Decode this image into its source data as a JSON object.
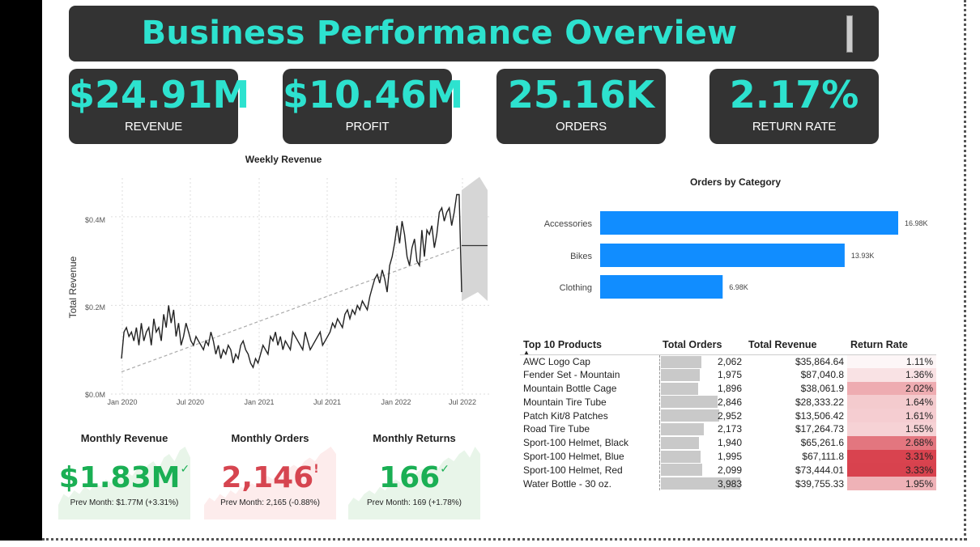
{
  "header": {
    "title": "Business Performance Overview"
  },
  "kpis": [
    {
      "value": "$24.91M",
      "label": "REVENUE"
    },
    {
      "value": "$10.46M",
      "label": "PROFIT"
    },
    {
      "value": "25.16K",
      "label": "ORDERS"
    },
    {
      "value": "2.17%",
      "label": "RETURN RATE"
    }
  ],
  "weekly_revenue": {
    "title": "Weekly Revenue",
    "ylabel": "Total Revenue",
    "yticks": [
      "$0.0M",
      "$0.2M",
      "$0.4M"
    ],
    "xticks": [
      "Jan 2020",
      "Jul 2020",
      "Jan 2021",
      "Jul 2021",
      "Jan 2022",
      "Jul 2022"
    ]
  },
  "orders_by_category": {
    "title": "Orders by Category",
    "categories": [
      "Accessories",
      "Bikes",
      "Clothing"
    ],
    "labels": [
      "16.98K",
      "13.93K",
      "6.98K"
    ]
  },
  "chart_data": [
    {
      "type": "line",
      "title": "Weekly Revenue",
      "xlabel": "",
      "ylabel": "Total Revenue",
      "ylim": [
        0,
        0.46
      ],
      "y_unit": "$M",
      "x_range": [
        "2020-01",
        "2022-07"
      ],
      "series": [
        {
          "values": [
            0.08,
            0.14,
            0.15,
            0.13,
            0.14,
            0.12,
            0.15,
            0.11,
            0.16,
            0.12,
            0.14,
            0.15,
            0.11,
            0.17,
            0.14,
            0.15,
            0.12,
            0.18,
            0.15,
            0.2,
            0.16,
            0.19,
            0.13,
            0.16,
            0.11,
            0.13,
            0.16,
            0.14,
            0.12,
            0.11,
            0.13,
            0.12,
            0.11,
            0.1,
            0.12,
            0.11,
            0.14,
            0.12,
            0.09,
            0.11,
            0.08,
            0.1,
            0.09,
            0.11,
            0.1,
            0.07,
            0.09,
            0.08,
            0.11,
            0.12,
            0.1,
            0.09,
            0.07,
            0.06,
            0.08,
            0.07,
            0.09,
            0.11,
            0.1,
            0.09,
            0.13,
            0.12,
            0.14,
            0.11,
            0.13,
            0.1,
            0.12,
            0.11,
            0.1,
            0.14,
            0.13,
            0.12,
            0.11,
            0.1,
            0.14,
            0.12,
            0.1,
            0.11,
            0.12,
            0.13,
            0.14,
            0.11,
            0.12,
            0.13,
            0.14,
            0.16,
            0.15,
            0.17,
            0.16,
            0.15,
            0.18,
            0.19,
            0.17,
            0.19,
            0.18,
            0.2,
            0.19,
            0.21,
            0.2,
            0.19,
            0.22,
            0.24,
            0.26,
            0.27,
            0.25,
            0.28,
            0.26,
            0.23,
            0.29,
            0.31,
            0.34,
            0.38,
            0.34,
            0.39,
            0.36,
            0.31,
            0.29,
            0.33,
            0.35,
            0.3,
            0.29,
            0.37,
            0.31,
            0.37,
            0.36,
            0.38,
            0.33,
            0.36,
            0.41,
            0.42,
            0.39,
            0.41,
            0.42,
            0.38,
            0.41,
            0.45,
            0.45,
            0.23
          ]
        },
        {
          "name": "trend",
          "values_start": 0.05,
          "values_end": 0.33
        },
        {
          "name": "forecast",
          "value": 0.335,
          "upper_start": 0.46,
          "lower_start": 0.21,
          "upper_end": 0.47,
          "lower_end": 0.21
        }
      ]
    },
    {
      "type": "bar",
      "title": "Orders by Category",
      "categories": [
        "Accessories",
        "Bikes",
        "Clothing"
      ],
      "values": [
        16980,
        13930,
        6980
      ],
      "orientation": "horizontal",
      "colors": [
        "#118dff"
      ]
    }
  ],
  "cards": [
    {
      "title": "Monthly Revenue",
      "value": "$1.83M",
      "mark": "✓",
      "prev": "Prev Month: $1.77M (+3.31%)",
      "color": "#1aaf54",
      "bg": "#e8f5e9",
      "spark": [
        0.2,
        0.35,
        0.3,
        0.4,
        0.35,
        0.45,
        0.4,
        0.5,
        0.45,
        0.55,
        0.5,
        0.6,
        0.55,
        0.65,
        0.6,
        0.7,
        0.65,
        0.75,
        0.8,
        0.7,
        0.85,
        0.9,
        0.8,
        0.95,
        1.0,
        0.85
      ]
    },
    {
      "title": "Monthly Orders",
      "value": "2,146",
      "mark": "!",
      "prev": "Prev Month: 2,165 (-0.88%)",
      "color": "#d64550",
      "bg": "#fdecec",
      "spark": [
        0.2,
        0.3,
        0.25,
        0.35,
        0.3,
        0.4,
        0.35,
        0.45,
        0.4,
        0.5,
        0.45,
        0.55,
        0.6,
        0.55,
        0.65,
        0.6,
        0.7,
        0.75,
        0.7,
        0.8,
        0.85,
        0.8,
        0.9,
        0.95,
        1.0,
        0.9
      ]
    },
    {
      "title": "Monthly Returns",
      "value": "166",
      "mark": "✓",
      "prev": "Prev Month: 169 (+1.78%)",
      "color": "#1aaf54",
      "bg": "#e8f5e9",
      "spark": [
        0.2,
        0.3,
        0.25,
        0.35,
        0.4,
        0.35,
        0.45,
        0.4,
        0.5,
        0.55,
        0.5,
        0.6,
        0.55,
        0.65,
        0.7,
        0.65,
        0.75,
        0.7,
        0.8,
        0.85,
        0.8,
        0.9,
        0.95,
        0.85,
        1.0,
        0.9
      ]
    }
  ],
  "products_table": {
    "columns": [
      "Top 10 Products",
      "Total Orders",
      "Total Revenue",
      "Return Rate"
    ],
    "rows": [
      {
        "name": "AWC Logo Cap",
        "orders": "2,062",
        "orders_value": 2062,
        "revenue": "$35,864.64",
        "rate": "1.11%",
        "rate_value": 1.11
      },
      {
        "name": "Fender Set - Mountain",
        "orders": "1,975",
        "orders_value": 1975,
        "revenue": "$87,040.8",
        "rate": "1.36%",
        "rate_value": 1.36
      },
      {
        "name": "Mountain Bottle Cage",
        "orders": "1,896",
        "orders_value": 1896,
        "revenue": "$38,061.9",
        "rate": "2.02%",
        "rate_value": 2.02
      },
      {
        "name": "Mountain Tire Tube",
        "orders": "2,846",
        "orders_value": 2846,
        "revenue": "$28,333.22",
        "rate": "1.64%",
        "rate_value": 1.64
      },
      {
        "name": "Patch Kit/8 Patches",
        "orders": "2,952",
        "orders_value": 2952,
        "revenue": "$13,506.42",
        "rate": "1.61%",
        "rate_value": 1.61
      },
      {
        "name": "Road Tire Tube",
        "orders": "2,173",
        "orders_value": 2173,
        "revenue": "$17,264.73",
        "rate": "1.55%",
        "rate_value": 1.55
      },
      {
        "name": "Sport-100 Helmet, Black",
        "orders": "1,940",
        "orders_value": 1940,
        "revenue": "$65,261.6",
        "rate": "2.68%",
        "rate_value": 2.68
      },
      {
        "name": "Sport-100 Helmet, Blue",
        "orders": "1,995",
        "orders_value": 1995,
        "revenue": "$67,111.8",
        "rate": "3.31%",
        "rate_value": 3.31
      },
      {
        "name": "Sport-100 Helmet, Red",
        "orders": "2,099",
        "orders_value": 2099,
        "revenue": "$73,444.01",
        "rate": "3.33%",
        "rate_value": 3.33
      },
      {
        "name": "Water Bottle - 30 oz.",
        "orders": "3,983",
        "orders_value": 3983,
        "revenue": "$39,755.33",
        "rate": "1.95%",
        "rate_value": 1.95
      }
    ]
  }
}
